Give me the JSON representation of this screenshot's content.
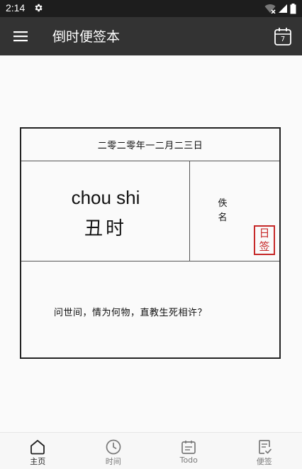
{
  "status_bar": {
    "time": "2:14"
  },
  "app_bar": {
    "title": "倒时便签本",
    "calendar_day": "7"
  },
  "card": {
    "date": "二零二零年一二月二三日",
    "pinyin": "chou shi",
    "hour": "丑时",
    "author_line1": "佚",
    "author_line2": "名",
    "seal_line1": "日",
    "seal_line2": "签",
    "quote": "问世间，情为何物，直教生死相许？",
    "seal_color": "#c62828"
  },
  "bottom_nav": {
    "items": [
      {
        "label": "主页",
        "icon": "home-icon"
      },
      {
        "label": "时间",
        "icon": "clock-icon"
      },
      {
        "label": "Todo",
        "icon": "todo-calendar-icon"
      },
      {
        "label": "便签",
        "icon": "note-check-icon"
      }
    ],
    "active_index": 0
  }
}
